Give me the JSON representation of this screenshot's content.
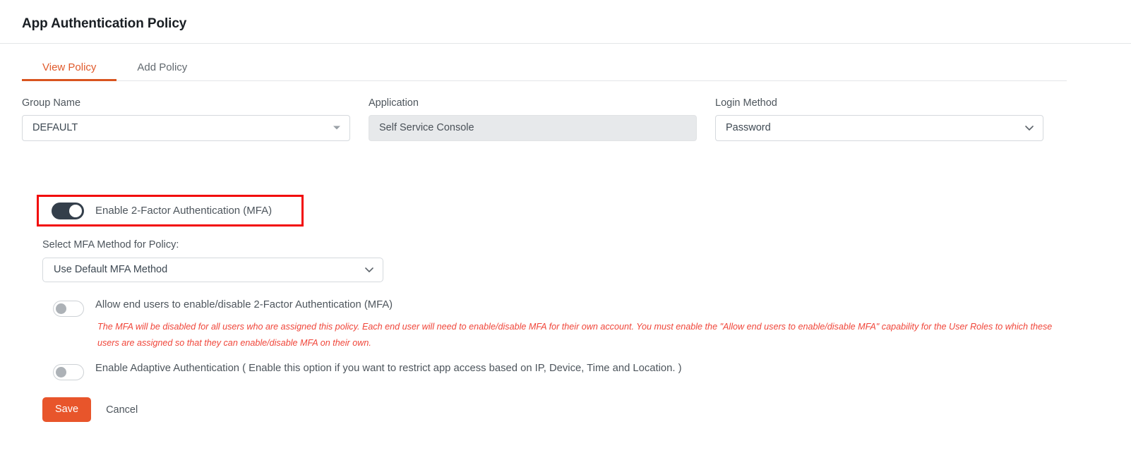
{
  "header": {
    "title": "App Authentication Policy"
  },
  "tabs": [
    {
      "label": "View Policy",
      "active": true
    },
    {
      "label": "Add Policy",
      "active": false
    }
  ],
  "form": {
    "group_name": {
      "label": "Group Name",
      "value": "DEFAULT",
      "icon": "caret-down-icon"
    },
    "application": {
      "label": "Application",
      "value": "Self Service Console",
      "readonly": true
    },
    "login_method": {
      "label": "Login Method",
      "value": "Password",
      "icon": "chevron-down-icon"
    }
  },
  "mfa_toggle": {
    "label": "Enable 2-Factor Authentication (MFA)",
    "state": "on",
    "highlighted": true
  },
  "mfa_method": {
    "label": "Select MFA Method for Policy:",
    "value": "Use Default MFA Method",
    "icon": "chevron-down-icon"
  },
  "options": [
    {
      "id": "allow-end-users",
      "label": "Allow end users to enable/disable 2-Factor Authentication (MFA)",
      "state": "off"
    },
    {
      "id": "adaptive-authentication",
      "label": "Enable Adaptive Authentication ( Enable this option if you want to restrict app access based on IP, Device, Time and Location. )",
      "state": "off"
    }
  ],
  "warning": {
    "text": "The MFA will be disabled for all users who are assigned this policy. Each end user will need to enable/disable MFA for their own account. You must enable the \"Allow end users to enable/disable MFA\" capability for the User Roles to which these users are assigned so that they can enable/disable MFA on their own."
  },
  "actions": {
    "save_label": "Save",
    "cancel_label": "Cancel"
  },
  "colors": {
    "accent_orange": "#e8552b",
    "tab_active": "#e05a2b",
    "toggle_on": "#343f4b",
    "warning_red": "#f0463a",
    "highlight_border": "#f20a0a"
  }
}
